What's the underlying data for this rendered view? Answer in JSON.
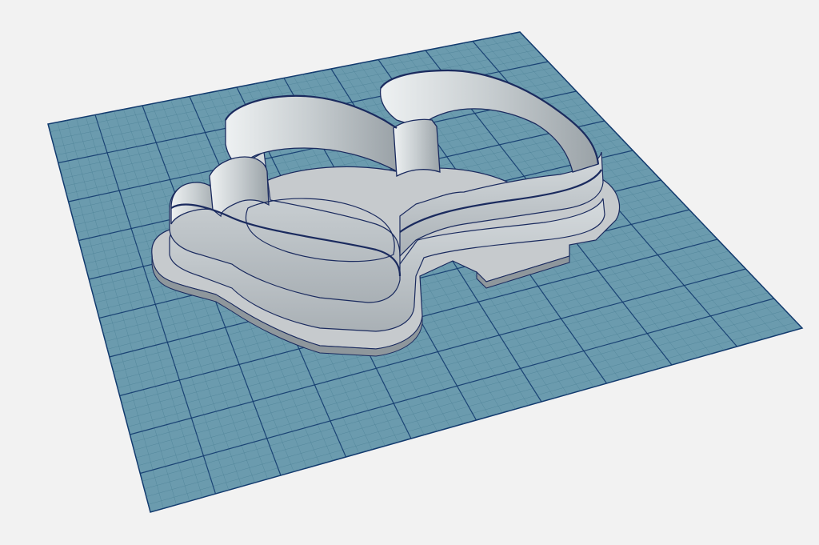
{
  "viewport": {
    "background_color": "#f2f2f2"
  },
  "ground_grid": {
    "fill_color": "#6b9bae",
    "fine_line_color": "#4a7f94",
    "major_line_color": "#123a6e",
    "major_divisions": 10,
    "minor_subdivisions": 5
  },
  "model": {
    "object": "cookie-cutter",
    "wall_color": "#b9bfc3",
    "wall_light_color": "#d8dde0",
    "wall_dark_color": "#8f979c",
    "base_color": "#c6cacd",
    "edge_color": "#1a2a5e"
  }
}
